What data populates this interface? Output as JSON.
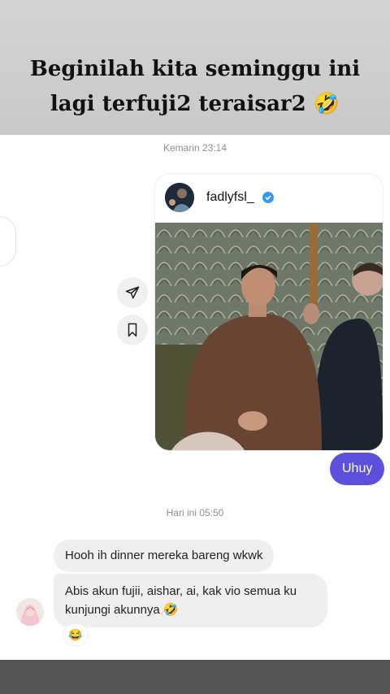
{
  "caption": {
    "line1": "Beginilah kita seminggu ini",
    "line2": "lagi terfuji2 teraisar2 🤣"
  },
  "timestamps": {
    "first": "Kemarin 23:14",
    "second": "Hari ini 05:50"
  },
  "shared_post": {
    "username": "fadlyfsl_",
    "verified": true
  },
  "actions": {
    "share_icon": "paper-plane-icon",
    "save_icon": "bookmark-icon"
  },
  "messages": {
    "sent": "Uhuy",
    "received_1": "Hooh ih dinner mereka bareng wkwk",
    "received_2": "Abis akun fujii, aishar, ai, kak vio semua ku kunjungi akunnya 🤣",
    "reaction": "😂"
  },
  "colors": {
    "sent_bubble": "#5b4fdb",
    "received_bubble": "#efefef",
    "verified_badge": "#3897f0"
  }
}
